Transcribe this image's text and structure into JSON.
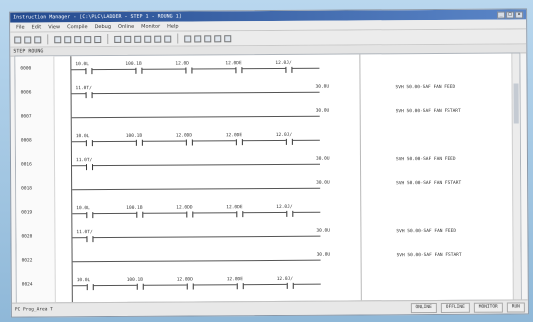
{
  "window": {
    "title": "Instruction Manager - [C:\\PLC\\LADDER - STEP 1 - ROUNG 1]",
    "btn_min": "_",
    "btn_max": "□",
    "btn_close": "×"
  },
  "menu": [
    "File",
    "Edit",
    "View",
    "Compile",
    "Debug",
    "Online",
    "Monitor",
    "Help"
  ],
  "subbar": {
    "label": "STEP  ROUNG"
  },
  "rungs": [
    {
      "step": "0000",
      "contacts": [
        "10.0L",
        "100.1B",
        "12.0D",
        "12.0DE",
        "12.0J/"
      ],
      "coil": "",
      "comment": ""
    },
    {
      "step": "0006",
      "contacts": [
        "11.0T/"
      ],
      "coil": "30.0U",
      "comment": "SVH 50.00-SAF FAN FEED"
    },
    {
      "step": "0007",
      "contacts": [],
      "coil": "30.0U",
      "comment": "SVH 50.00-SAF FAN FSTART"
    },
    {
      "step": "0008",
      "contacts": [
        "10.0L",
        "100.1B",
        "12.0DD",
        "12.0DE",
        "12.0J/"
      ],
      "coil": "",
      "comment": ""
    },
    {
      "step": "0016",
      "contacts": [
        "11.0T/"
      ],
      "coil": "30.0U",
      "comment": "SVH 50.00-SAF FAN FEED"
    },
    {
      "step": "0018",
      "contacts": [],
      "coil": "30.0U",
      "comment": "SVH 50.00-SAF FAN FSTART"
    },
    {
      "step": "0019",
      "contacts": [
        "10.0L",
        "100.1B",
        "12.0DD",
        "12.0DE",
        "12.0J/"
      ],
      "coil": "",
      "comment": ""
    },
    {
      "step": "0020",
      "contacts": [
        "11.0T/"
      ],
      "coil": "30.0U",
      "comment": "SVH 50.00-SAF FAN FEED"
    },
    {
      "step": "0022",
      "contacts": [],
      "coil": "30.0U",
      "comment": "SVH 50.00-SAF FAN FSTART"
    },
    {
      "step": "0024",
      "contacts": [
        "10.0L",
        "100.1B",
        "12.0DD",
        "12.0DE",
        "12.0J/"
      ],
      "coil": "",
      "comment": ""
    }
  ],
  "status": {
    "left": "PC Prog_Area T",
    "p1": "ONLINE",
    "p2": "OFFLINE",
    "p3": "MONITOR",
    "p4": "RUN"
  }
}
